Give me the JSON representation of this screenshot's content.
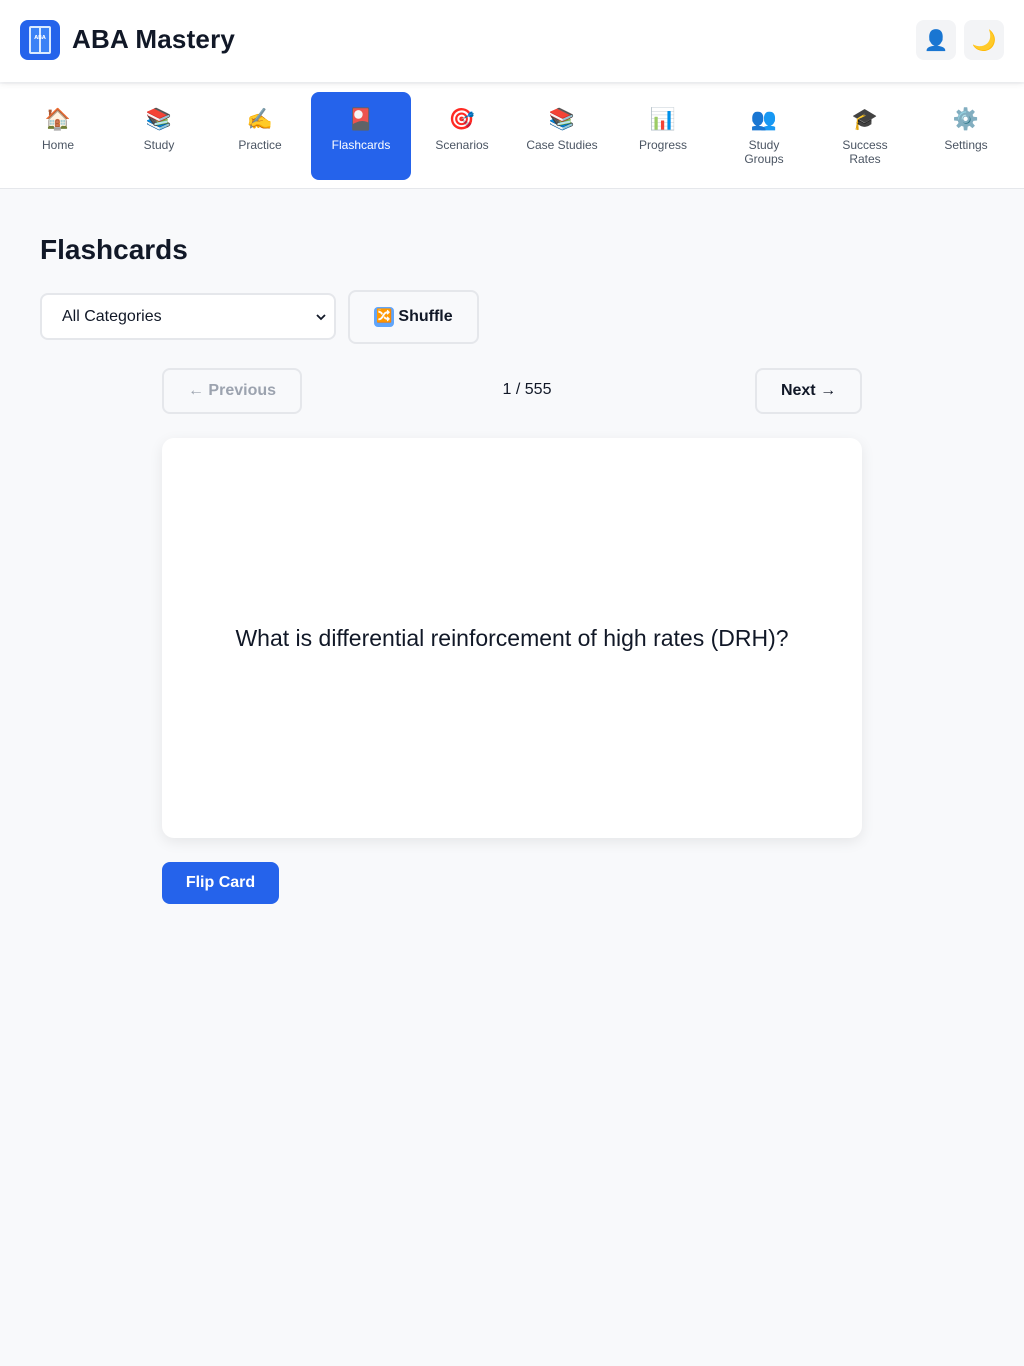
{
  "app": {
    "title": "ABA Mastery",
    "logo_text": "ABA",
    "user_icon": "👤",
    "theme_icon": "🌙"
  },
  "nav": {
    "items": [
      {
        "icon": "🏠",
        "label": "Home"
      },
      {
        "icon": "📚",
        "label": "Study"
      },
      {
        "icon": "✍️",
        "label": "Practice"
      },
      {
        "icon": "🎴",
        "label": "Flashcards"
      },
      {
        "icon": "🎯",
        "label": "Scenarios"
      },
      {
        "icon": "📚",
        "label": "Case Studies"
      },
      {
        "icon": "📊",
        "label": "Progress"
      },
      {
        "icon": "👥",
        "label": "Study Groups"
      },
      {
        "icon": "🎓",
        "label": "Success Rates"
      },
      {
        "icon": "⚙️",
        "label": "Settings"
      }
    ],
    "active": "Flashcards"
  },
  "flashcards": {
    "title": "Flashcards",
    "category_select": "All Categories",
    "shuffle_icon": "🔀",
    "shuffle_label": "Shuffle",
    "previous_label": "← Previous",
    "next_label": "Next →",
    "counter": "1 / 555",
    "question": "What is differential reinforcement of high rates (DRH)?",
    "flip_label": "Flip Card"
  },
  "colors": {
    "accent": "#2563eb",
    "background": "#f8f9fb"
  }
}
